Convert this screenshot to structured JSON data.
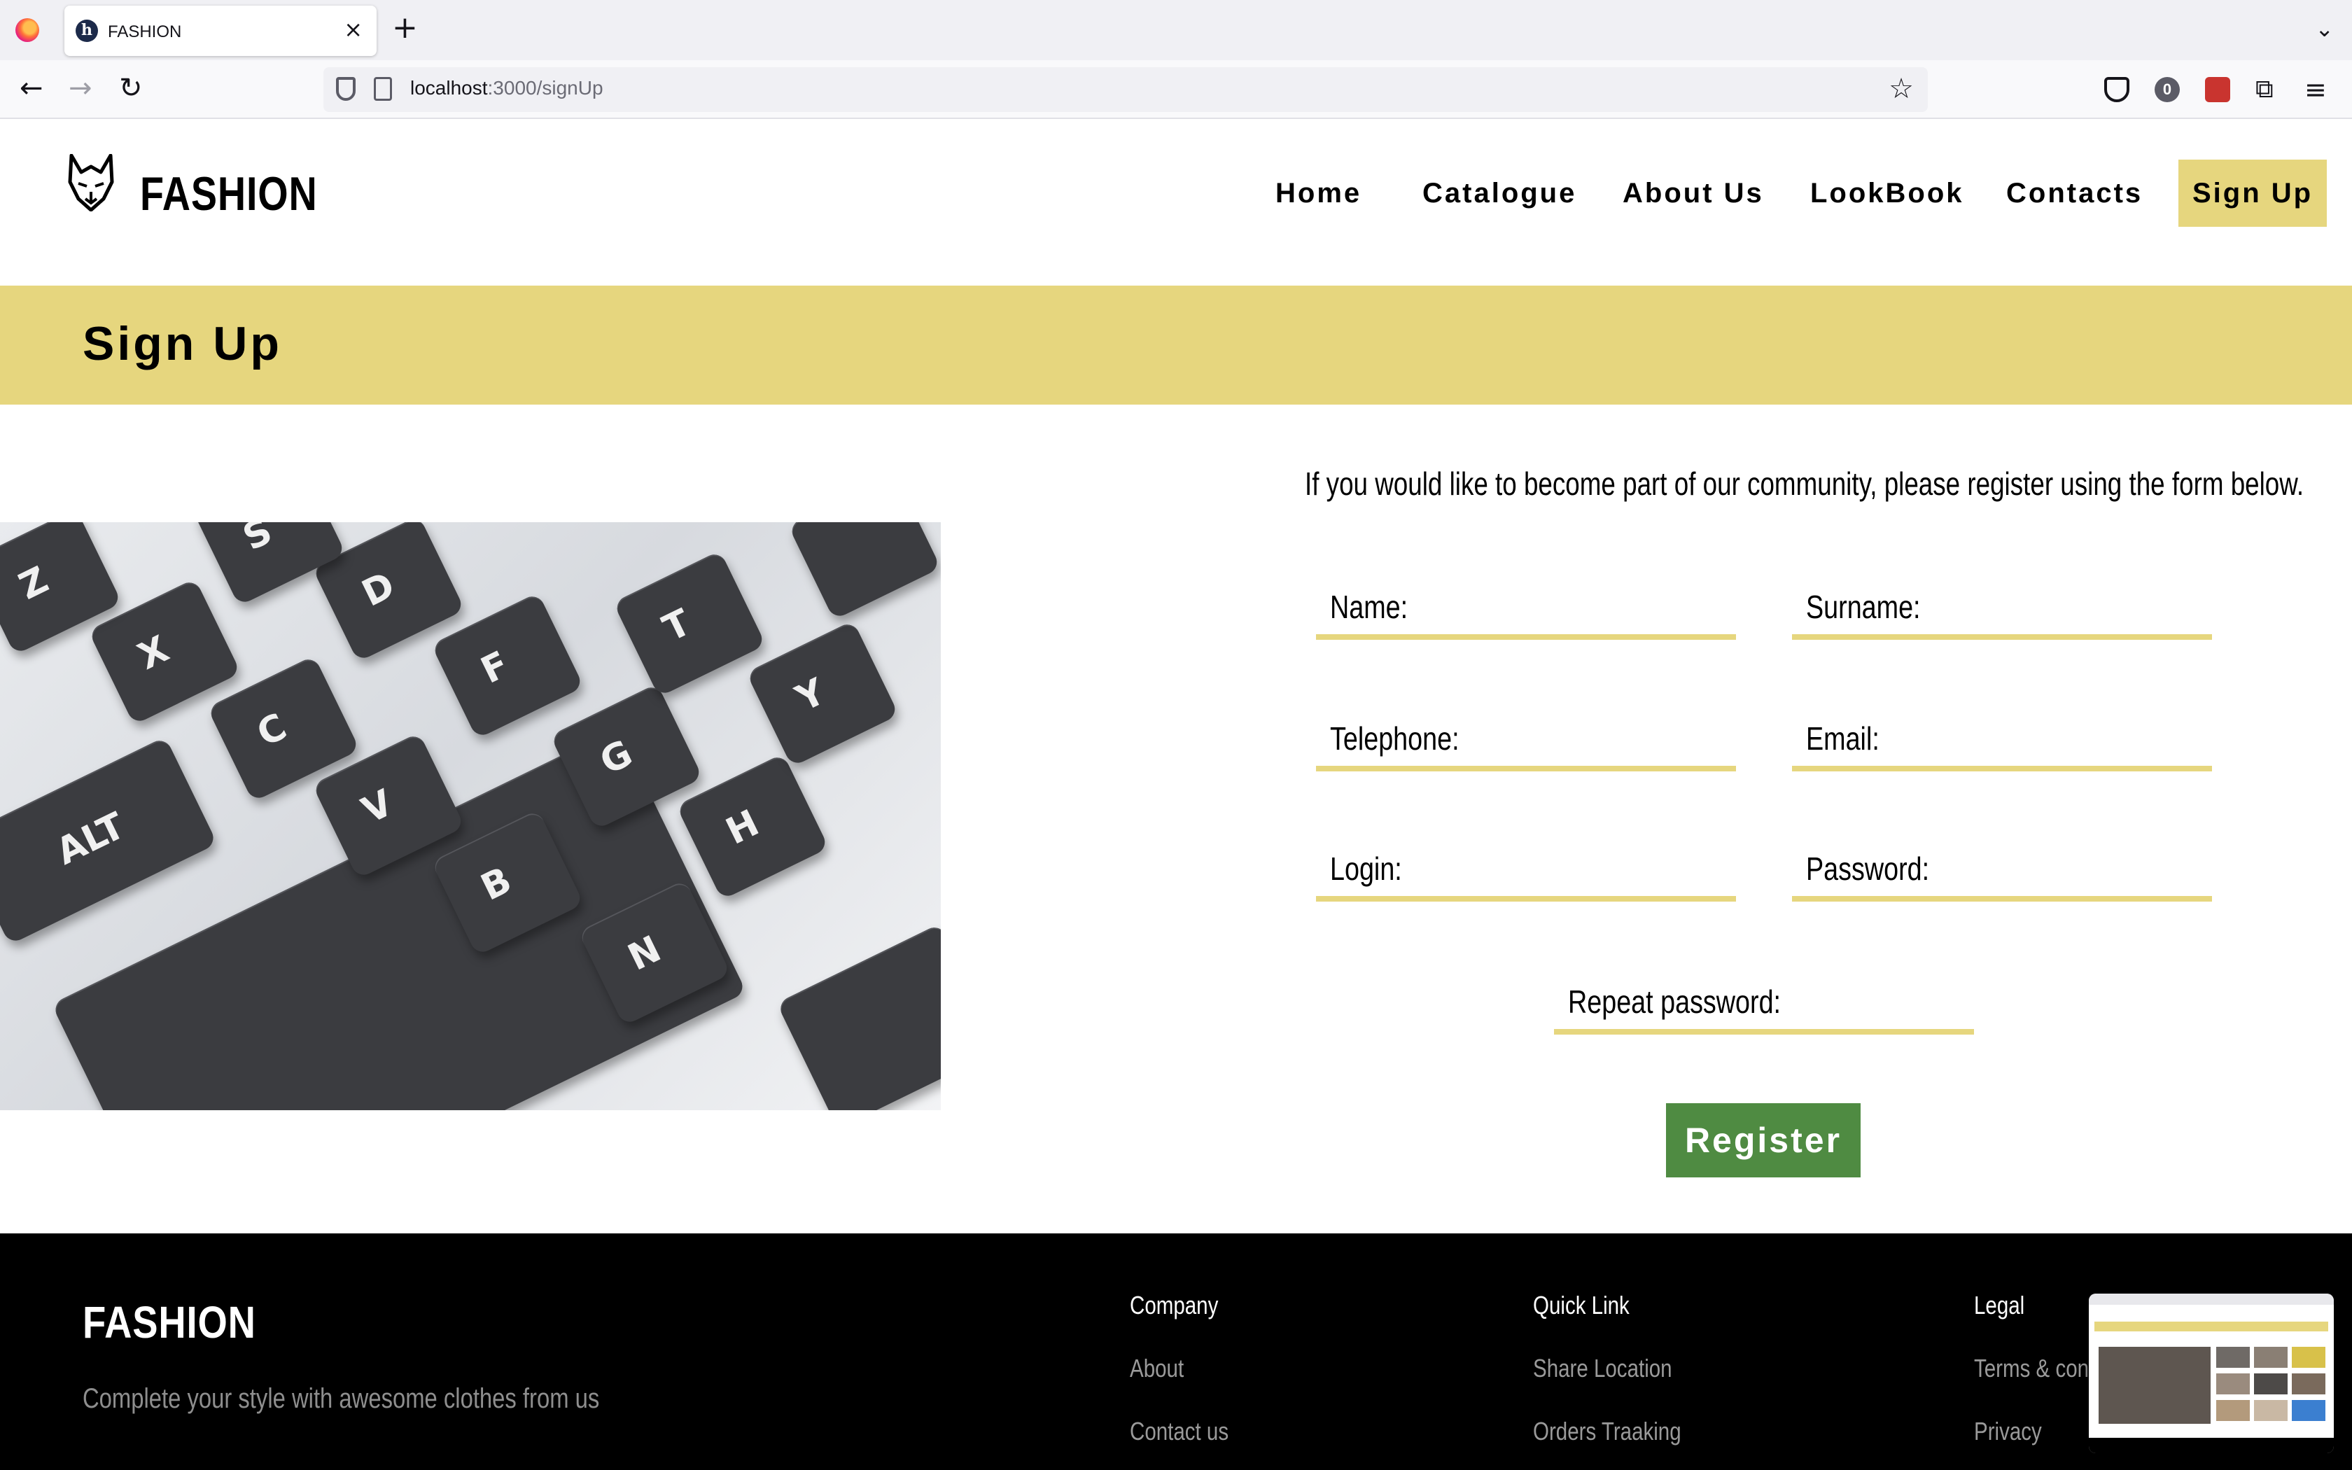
{
  "browser": {
    "tab_title": "FASHION",
    "tab_favicon": "h",
    "url_host": "localhost",
    "url_path": ":3000/signUp",
    "badge_count": "0"
  },
  "site": {
    "brand": "FASHION",
    "nav": [
      "Home",
      "Catalogue",
      "About Us",
      "LookBook",
      "Contacts",
      "Sign Up"
    ],
    "accent_color": "#e6d67e"
  },
  "page": {
    "title": "Sign Up",
    "intro": "If you would like to become part of our community, please register using the form below."
  },
  "form": {
    "name_label": "Name:",
    "surname_label": "Surname:",
    "telephone_label": "Telephone:",
    "email_label": "Email:",
    "login_label": "Login:",
    "password_label": "Password:",
    "repeat_password_label": "Repeat password:",
    "register_label": "Register",
    "register_color": "#4f8b42"
  },
  "keyboard_image": {
    "keys": [
      "ALT",
      "C",
      "V",
      "B",
      "N",
      "F",
      "G",
      "H",
      "T",
      "Y",
      "D",
      "S",
      "X",
      "Z"
    ]
  },
  "footer": {
    "brand": "FASHION",
    "tagline": "Complete your style with awesome clothes from us",
    "columns": [
      {
        "heading": "Company",
        "links": [
          "About",
          "Contact us"
        ]
      },
      {
        "heading": "Quick Link",
        "links": [
          "Share Location",
          "Orders Traaking"
        ]
      },
      {
        "heading": "Legal",
        "links": [
          "Terms & condit",
          "Privacy"
        ]
      }
    ]
  }
}
